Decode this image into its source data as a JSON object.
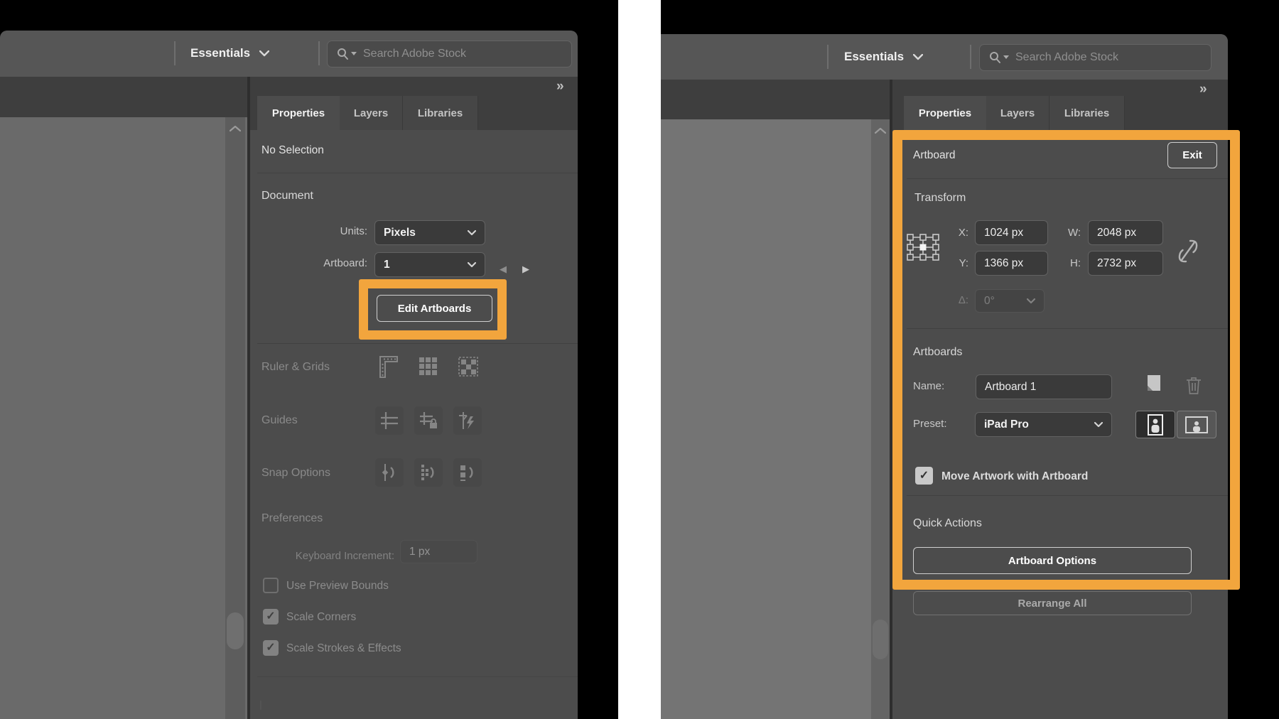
{
  "colors": {
    "highlight_orange": "#F2A53D",
    "panel_bg": "#4C4C4C",
    "topbar_bg": "#565656",
    "canvas_left": "#6A6A6A",
    "canvas_right": "#747474"
  },
  "icons": {
    "collapse_glyph": "»",
    "prev_artboard": "◀",
    "next_artboard": "▶"
  },
  "left": {
    "topbar": {
      "workspace": "Essentials",
      "search_placeholder": "Search Adobe Stock"
    },
    "tabs": [
      "Properties",
      "Layers",
      "Libraries"
    ],
    "panel": {
      "no_selection": "No Selection",
      "document_header": "Document",
      "units_label": "Units:",
      "units_value": "Pixels",
      "artboard_label": "Artboard:",
      "artboard_value": "1",
      "edit_artboards_button": "Edit Artboards",
      "ruler_grids_label": "Ruler & Grids",
      "guides_label": "Guides",
      "snap_options_label": "Snap Options",
      "preferences_header": "Preferences",
      "keyboard_increment_label": "Keyboard Increment:",
      "keyboard_increment_value": "1 px",
      "checkboxes": [
        {
          "label": "Use Preview Bounds",
          "checked": false
        },
        {
          "label": "Scale Corners",
          "checked": true
        },
        {
          "label": "Scale Strokes & Effects",
          "checked": true
        }
      ]
    }
  },
  "right": {
    "topbar": {
      "workspace": "Essentials",
      "search_placeholder": "Search Adobe Stock"
    },
    "tabs": [
      "Properties",
      "Layers",
      "Libraries"
    ],
    "panel": {
      "artboard_header": "Artboard",
      "exit_button": "Exit",
      "transform_header": "Transform",
      "x_label": "X:",
      "x_value": "1024 px",
      "y_label": "Y:",
      "y_value": "1366 px",
      "w_label": "W:",
      "w_value": "2048 px",
      "h_label": "H:",
      "h_value": "2732 px",
      "angle_label": "Δ:",
      "angle_value": "0°",
      "artboards_header": "Artboards",
      "name_label": "Name:",
      "name_value": "Artboard 1",
      "preset_label": "Preset:",
      "preset_value": "iPad Pro",
      "move_artwork": {
        "label": "Move Artwork with Artboard",
        "checked": true
      },
      "quick_actions_header": "Quick Actions",
      "artboard_options_button": "Artboard Options",
      "rearrange_all_button": "Rearrange All"
    }
  }
}
